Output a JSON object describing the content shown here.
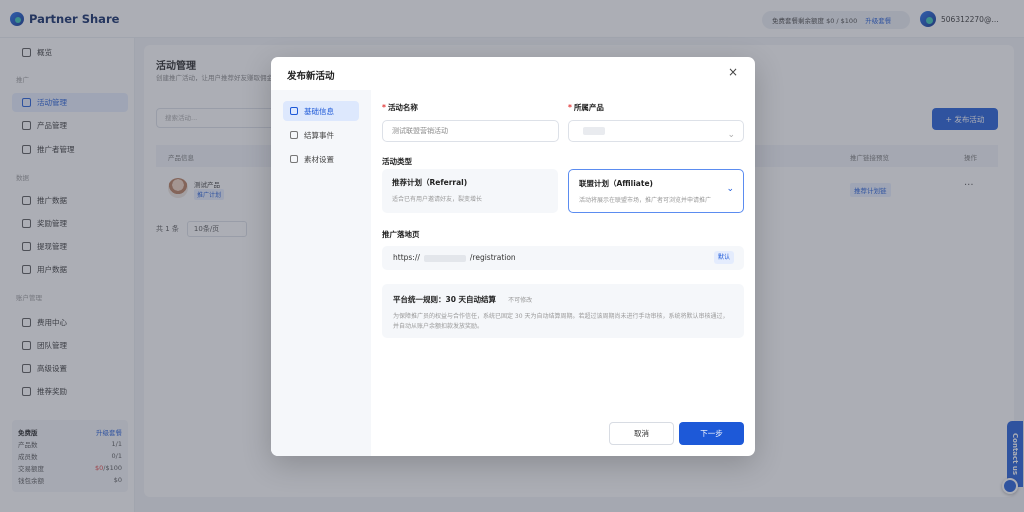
{
  "app": {
    "logo_text": "Partner Share",
    "quota_text": "免费套餐剩余额度 $0 / $100",
    "quota_upgrade": "升级套餐",
    "username": "506312270@..."
  },
  "sidebar": {
    "items": [
      {
        "label": "概览"
      },
      {
        "label": "活动管理"
      },
      {
        "label": "产品管理"
      },
      {
        "label": "推广者管理"
      },
      {
        "label": "推广数据"
      },
      {
        "label": "奖励管理"
      },
      {
        "label": "提现管理"
      },
      {
        "label": "用户数据"
      },
      {
        "label": "费用中心"
      },
      {
        "label": "团队管理"
      },
      {
        "label": "高级设置"
      },
      {
        "label": "推荐奖励"
      }
    ],
    "groups": [
      "推广",
      "数据",
      "账户管理"
    ],
    "plan": {
      "name": "免费版",
      "upgrade": "升级套餐",
      "rows": [
        {
          "label": "产品数",
          "value": "1/1"
        },
        {
          "label": "成员数",
          "value": "0/1"
        },
        {
          "label": "交易额度",
          "value_used": "$0",
          "value_total": "/$100"
        },
        {
          "label": "钱包余额",
          "value": "$0"
        }
      ]
    }
  },
  "main": {
    "title": "活动管理",
    "subtitle": "创建推广活动，让用户推荐好友赚取佣金",
    "search_placeholder": "搜索活动...",
    "publish_button": "+ 发布活动",
    "table": {
      "headers": [
        "产品信息",
        "推广链接预览",
        "操作"
      ],
      "row": {
        "name": "测试产品",
        "tag": "推广计划",
        "link_tag": "推荐计划链",
        "more": "···"
      }
    },
    "pager": {
      "total": "共 1 条",
      "page_size": "10条/页"
    }
  },
  "contact": {
    "label": "Contact us"
  },
  "modal": {
    "title": "发布新活动",
    "close": "×",
    "nav": [
      {
        "label": "基础信息"
      },
      {
        "label": "结算事件"
      },
      {
        "label": "素材设置"
      }
    ],
    "form": {
      "name_label": "活动名称",
      "name_value": "测试联盟营销活动",
      "product_label": "所属产品",
      "type_label": "活动类型",
      "type_options": [
        {
          "name": "推荐计划（Referral)",
          "desc": "适合已有用户邀请好友，裂变增长"
        },
        {
          "name": "联盟计划（Affiliate)",
          "desc": "活动将展示在联盟市场，推广者可浏览并申请推广"
        }
      ],
      "landing_label": "推广落地页",
      "landing_url_prefix": "https://",
      "landing_url_suffix": "/registration",
      "landing_tag": "默认",
      "rule_title": "平台统一规则：30 天自动结算",
      "rule_chip": "不可修改",
      "rule_text": "为保障推广员的权益与合作信任，系统已固定 30 天为自动结算周期。若超过该周期尚未进行手动审核，系统将默认审核通过，并自动从账户余额扣款发放奖励。"
    },
    "cancel_button": "取消",
    "next_button": "下一步"
  }
}
